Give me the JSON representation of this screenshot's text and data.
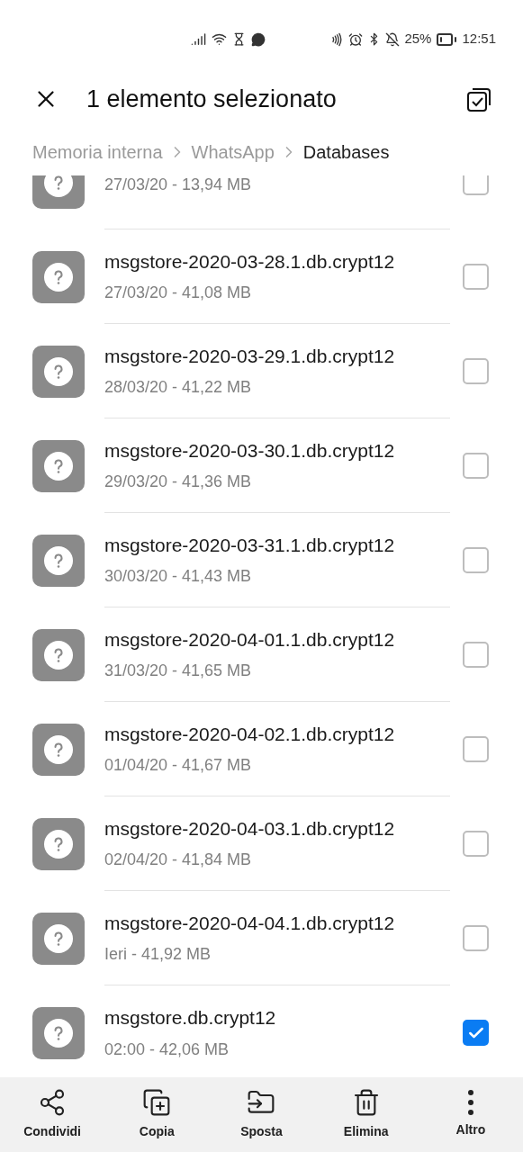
{
  "status_bar": {
    "battery": "25%",
    "time": "12:51"
  },
  "header": {
    "title": "1 elemento selezionato"
  },
  "breadcrumb": [
    {
      "label": "Memoria interna",
      "current": false
    },
    {
      "label": "WhatsApp",
      "current": false
    },
    {
      "label": "Databases",
      "current": true
    }
  ],
  "files": [
    {
      "details": "27/03/20 - 13,94 MB",
      "checked": false
    },
    {
      "name": "msgstore-2020-03-28.1.db.crypt12",
      "details": "27/03/20 - 41,08 MB",
      "checked": false
    },
    {
      "name": "msgstore-2020-03-29.1.db.crypt12",
      "details": "28/03/20 - 41,22 MB",
      "checked": false
    },
    {
      "name": "msgstore-2020-03-30.1.db.crypt12",
      "details": "29/03/20 - 41,36 MB",
      "checked": false
    },
    {
      "name": "msgstore-2020-03-31.1.db.crypt12",
      "details": "30/03/20 - 41,43 MB",
      "checked": false
    },
    {
      "name": "msgstore-2020-04-01.1.db.crypt12",
      "details": "31/03/20 - 41,65 MB",
      "checked": false
    },
    {
      "name": "msgstore-2020-04-02.1.db.crypt12",
      "details": "01/04/20 - 41,67 MB",
      "checked": false
    },
    {
      "name": "msgstore-2020-04-03.1.db.crypt12",
      "details": "02/04/20 - 41,84 MB",
      "checked": false
    },
    {
      "name": "msgstore-2020-04-04.1.db.crypt12",
      "details": "Ieri - 41,92 MB",
      "checked": false
    },
    {
      "name": "msgstore.db.crypt12",
      "details": "02:00 - 42,06 MB",
      "checked": true
    }
  ],
  "toolbar": [
    {
      "kind": "share",
      "label": "Condividi"
    },
    {
      "kind": "copy",
      "label": "Copia"
    },
    {
      "kind": "move",
      "label": "Sposta"
    },
    {
      "kind": "delete",
      "label": "Elimina"
    },
    {
      "kind": "more",
      "label": "Altro"
    }
  ]
}
